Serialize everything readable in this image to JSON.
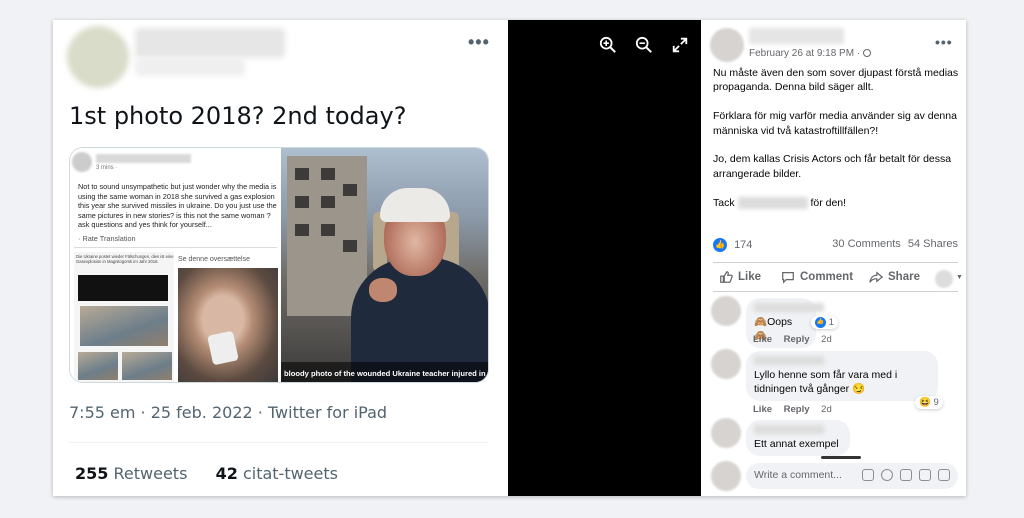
{
  "tweet": {
    "text": "1st photo 2018? 2nd today?",
    "meta": "7:55 em · 25 feb. 2022 · Twitter for iPad",
    "retweets_count": "255",
    "retweets_label": "Retweets",
    "quotes_count": "42",
    "quotes_label": "citat-tweets",
    "more_label": "•••"
  },
  "embedded_post": {
    "time": "3 mins · ",
    "text": "Not to sound unsympathetic but just wonder why the media is using the same woman in 2018 she survived a gas explosion this year she survived missiles in ukraine. Do you just use the same pictures in new stories? is this not the same woman ? ask questions and yes think for yourself...",
    "rate_translation": "· Rate Translation",
    "left_col_text": "Die Ukraine postet wieder Fälschungen, dies ist eine Gasexplosion in Magnitogorsk im Jahr 2018.",
    "translate_label": "Se denne oversættelse",
    "photo_caption": "bloody photo of the wounded Ukraine teacher injured in R"
  },
  "post": {
    "date": "February 26 at 9:18 PM · ",
    "paragraphs": [
      "Nu måste även den som sover djupast förstå medias propaganda. Denna bild säger allt.",
      "Förklara för mig varför media använder sig av denna människa vid två katastroftillfällen?!",
      "Jo, dem kallas Crisis Actors och får betalt för dessa arrangerade bilder."
    ],
    "thanks_prefix": "Tack",
    "thanks_suffix": "för den!",
    "likes_count": "174",
    "comments_count": "30 Comments",
    "shares_count": "54 Shares",
    "like_label": "Like",
    "comment_label": "Comment",
    "share_label": "Share",
    "more_label": "•••"
  },
  "comments": [
    {
      "text": "🙈Oops 🙈",
      "reaction_count": "1",
      "like_label": "Like",
      "reply_label": "Reply",
      "age": "2d"
    },
    {
      "text": "Lyllo henne som får vara med i tidningen två gånger 😏",
      "reaction_count": "9",
      "like_label": "Like",
      "reply_label": "Reply",
      "age": "2d"
    },
    {
      "text": "Ett annat exempel"
    }
  ],
  "comment_box": {
    "placeholder": "Write a comment..."
  }
}
